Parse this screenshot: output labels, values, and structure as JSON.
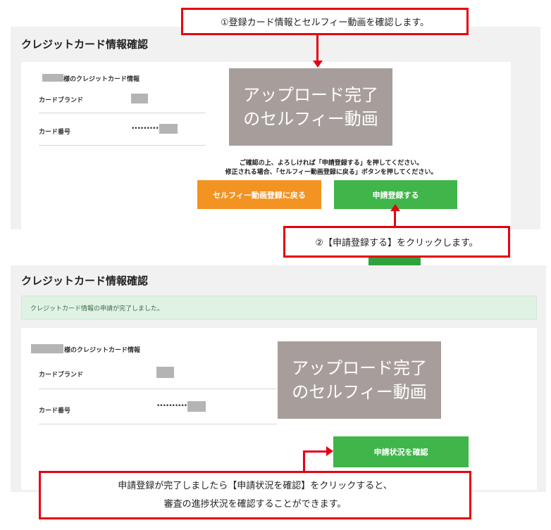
{
  "callouts": {
    "step1": "①登録カード情報とセルフィー動画を確認します。",
    "step2": "②【申請登録する】をクリックします。",
    "step3_line1": "申請登録が完了しましたら【申請状況を確認】をクリックすると、",
    "step3_line2": "審査の進捗状況を確認することができます。"
  },
  "screen1": {
    "title": "クレジットカード情報確認",
    "holder_suffix": "様のクレジットカード情報",
    "card_brand_label": "カードブランド",
    "card_number_label": "カード番号",
    "card_number_mask": "•••••••••••",
    "video_line1": "アップロード完了",
    "video_line2": "のセルフィー動画",
    "notice_line1": "ご確認の上、よろしければ「申請登録する」を押してください。",
    "notice_line2": "修正される場合、「セルフィー動画登録に戻る」ボタンを押してください。",
    "back_button": "セルフィー動画登録に戻る",
    "submit_button": "申請登録する"
  },
  "screen2": {
    "title": "クレジットカード情報確認",
    "success_message": "クレジットカード情報の申請が完了しました。",
    "holder_suffix": "様のクレジットカード情報",
    "card_brand_label": "カードブランド",
    "card_number_label": "カード番号",
    "card_number_mask": "•••••••••••",
    "video_line1": "アップロード完了",
    "video_line2": "のセルフィー動画",
    "status_button": "申請状況を確認"
  },
  "colors": {
    "accent_red": "#e60012",
    "button_green": "#3fb54a",
    "button_orange": "#f39322",
    "arrow_green": "#2ea33d",
    "video_placeholder": "#a79e9b"
  }
}
